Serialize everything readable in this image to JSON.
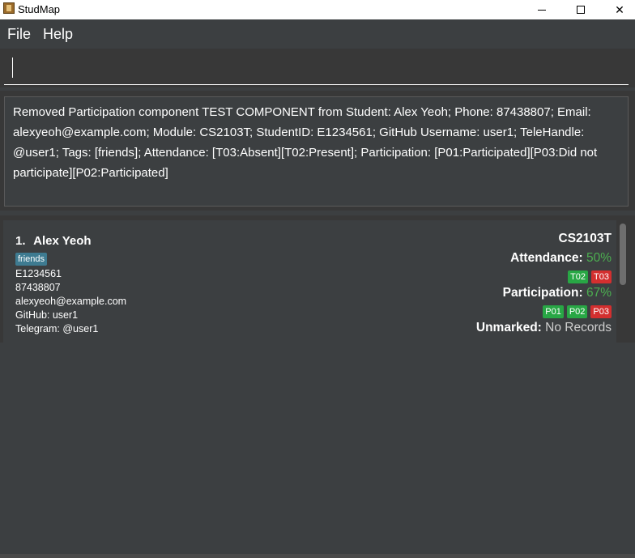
{
  "window": {
    "title": "StudMap",
    "minimize_symbol": "",
    "maximize_symbol": "",
    "close_symbol": "✕"
  },
  "menu": {
    "file": "File",
    "help": "Help"
  },
  "command": {
    "value": ""
  },
  "result": {
    "text": "Removed Participation component TEST COMPONENT from Student: Alex Yeoh; Phone: 87438807; Email: alexyeoh@example.com; Module: CS2103T; StudentID: E1234561; GitHub Username: user1; TeleHandle: @user1; Tags: [friends]; Attendance: [T03:Absent][T02:Present]; Participation: [P01:Participated][P03:Did not participate][P02:Participated]"
  },
  "students": [
    {
      "index": "1.",
      "name": "Alex Yeoh",
      "tag": "friends",
      "student_id": "E1234561",
      "phone": "87438807",
      "email": "alexyeoh@example.com",
      "github": "GitHub: user1",
      "telegram": "Telegram: @user1",
      "module": "CS2103T",
      "attendance_label": "Attendance:",
      "attendance_pct": "50%",
      "attendance_badges": [
        {
          "label": "T02",
          "status": "green"
        },
        {
          "label": "T03",
          "status": "red"
        }
      ],
      "participation_label": "Participation:",
      "participation_pct": "67%",
      "participation_badges": [
        {
          "label": "P01",
          "status": "green"
        },
        {
          "label": "P02",
          "status": "green"
        },
        {
          "label": "P03",
          "status": "red"
        }
      ],
      "unmarked_label": "Unmarked:",
      "unmarked_value": "No Records"
    }
  ],
  "colors": {
    "background": "#3c3f41",
    "panel": "#383838",
    "tag": "#3e7b91",
    "badge_green": "#28a745",
    "badge_red": "#d32f2f",
    "percent_green": "#4caf50"
  }
}
